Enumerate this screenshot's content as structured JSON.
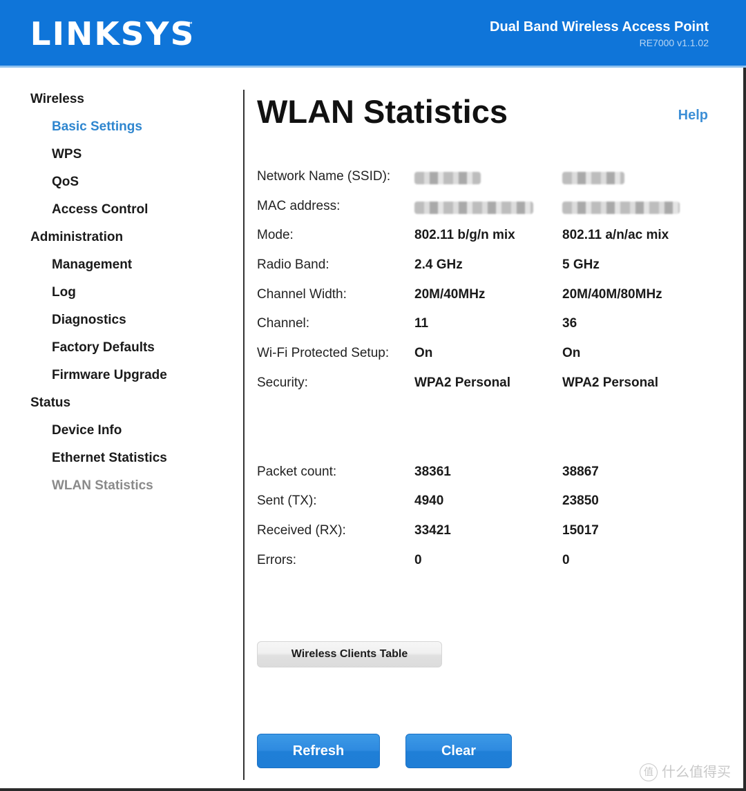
{
  "header": {
    "logo": "LINKSYS",
    "logo_tm": "™",
    "product_title": "Dual Band Wireless Access Point",
    "product_model": "RE7000 v1.1.02"
  },
  "sidebar": {
    "sections": [
      {
        "label": "Wireless",
        "items": [
          {
            "label": "Basic Settings",
            "state": "link"
          },
          {
            "label": "WPS"
          },
          {
            "label": "QoS"
          },
          {
            "label": "Access Control"
          }
        ]
      },
      {
        "label": "Administration",
        "items": [
          {
            "label": "Management"
          },
          {
            "label": "Log"
          },
          {
            "label": "Diagnostics"
          },
          {
            "label": "Factory Defaults"
          },
          {
            "label": "Firmware Upgrade"
          }
        ]
      },
      {
        "label": "Status",
        "items": [
          {
            "label": "Device Info"
          },
          {
            "label": "Ethernet Statistics"
          },
          {
            "label": "WLAN Statistics",
            "state": "active"
          }
        ]
      }
    ]
  },
  "main": {
    "title": "WLAN Statistics",
    "help_label": "Help",
    "info_rows": [
      {
        "label": "Network Name (SSID):",
        "band24": "[redacted]",
        "band5": "[redacted]",
        "redacted": true
      },
      {
        "label": "MAC address:",
        "band24": "[redacted]",
        "band5": "[redacted]",
        "redacted": true
      },
      {
        "label": "Mode:",
        "band24": "802.11 b/g/n mix",
        "band5": "802.11 a/n/ac mix"
      },
      {
        "label": "Radio Band:",
        "band24": "2.4 GHz",
        "band5": "5 GHz"
      },
      {
        "label": "Channel Width:",
        "band24": "20M/40MHz",
        "band5": "20M/40M/80MHz"
      },
      {
        "label": "Channel:",
        "band24": "11",
        "band5": "36"
      },
      {
        "label": "Wi-Fi Protected Setup:",
        "band24": "On",
        "band5": "On"
      },
      {
        "label": "Security:",
        "band24": "WPA2 Personal",
        "band5": "WPA2 Personal"
      }
    ],
    "stat_rows": [
      {
        "label": "Packet count:",
        "band24": "38361",
        "band5": "38867"
      },
      {
        "label": "Sent (TX):",
        "band24": "4940",
        "band5": "23850"
      },
      {
        "label": "Received (RX):",
        "band24": "33421",
        "band5": "15017"
      },
      {
        "label": "Errors:",
        "band24": "0",
        "band5": "0"
      }
    ],
    "wireless_clients_button": "Wireless Clients Table",
    "refresh_button": "Refresh",
    "clear_button": "Clear"
  },
  "watermark": {
    "icon_char": "值",
    "text": "什么值得买"
  }
}
